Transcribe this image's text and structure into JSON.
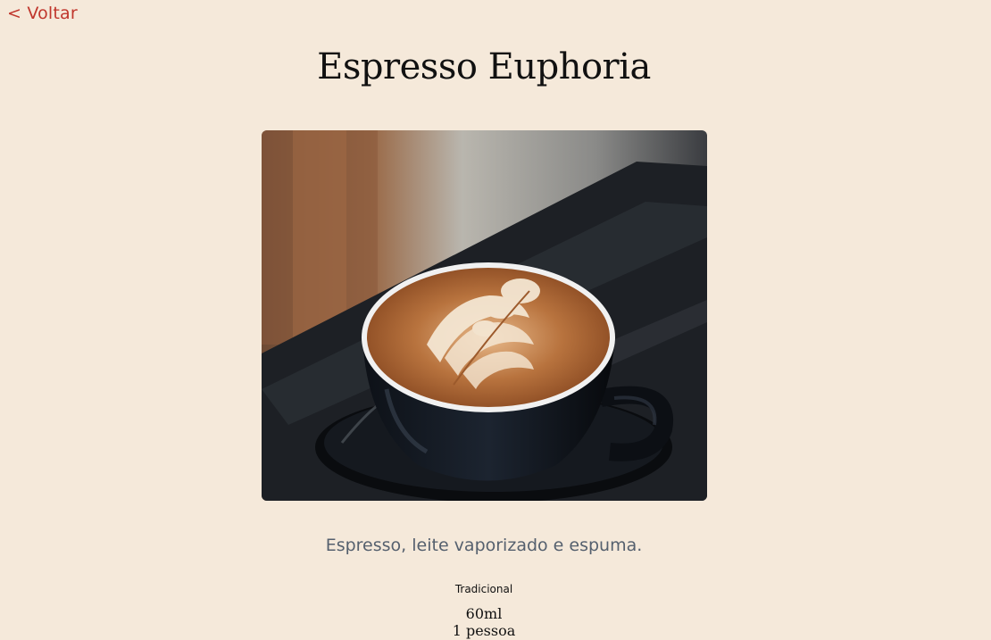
{
  "nav": {
    "back_label": "< Voltar"
  },
  "product": {
    "name": "Espresso Euphoria",
    "image_alt": "latte art coffee cup",
    "description": "Espresso, leite vaporizado e espuma.",
    "category": "Tradicional",
    "volume": "60ml",
    "servings": "1 pessoa"
  },
  "colors": {
    "background": "#f5e9da",
    "accent": "#c0362c",
    "description_text": "#55606e"
  }
}
